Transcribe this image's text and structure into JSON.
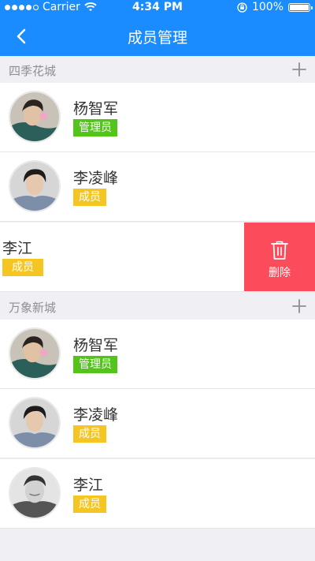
{
  "status_bar": {
    "carrier": "Carrier",
    "time": "4:34 PM",
    "battery": "100%"
  },
  "nav": {
    "title": "成员管理",
    "back_icon": "chevron-left-icon"
  },
  "groups": [
    {
      "name": "四季花城",
      "add_icon": "plus-icon",
      "members": [
        {
          "name": "杨智军",
          "role": "管理员",
          "role_type": "admin"
        },
        {
          "name": "李凌峰",
          "role": "成员",
          "role_type": "member"
        },
        {
          "name": "李江",
          "role": "成员",
          "role_type": "member",
          "swiped": true,
          "action_label": "删除",
          "action_icon": "trash-icon"
        }
      ]
    },
    {
      "name": "万象新城",
      "add_icon": "plus-icon",
      "members": [
        {
          "name": "杨智军",
          "role": "管理员",
          "role_type": "admin"
        },
        {
          "name": "李凌峰",
          "role": "成员",
          "role_type": "member"
        },
        {
          "name": "李江",
          "role": "成员",
          "role_type": "member"
        }
      ]
    }
  ],
  "colors": {
    "primary": "#1a8cff",
    "admin_badge": "#52c41a",
    "member_badge": "#f5c623",
    "delete": "#fc4b5a",
    "background": "#efeff4"
  }
}
